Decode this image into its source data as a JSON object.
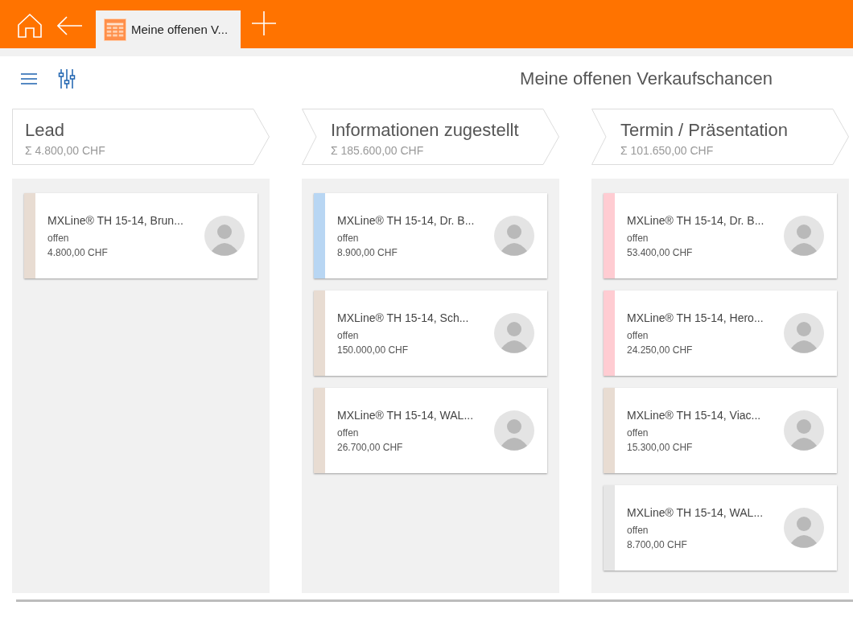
{
  "tabs": [
    {
      "label": "Meine offenen V...",
      "selected": true
    }
  ],
  "page_title": "Meine offenen Verkaufschancen",
  "columns": [
    {
      "title": "Lead",
      "sum": "Σ 4.800,00 CHF",
      "cards": [
        {
          "title": "MXLine® TH 15-14, Brun...",
          "status": "offen",
          "amount": "4.800,00 CHF",
          "color": "#e8dcd2"
        }
      ]
    },
    {
      "title": "Informationen zugestellt",
      "sum": "Σ 185.600,00 CHF",
      "cards": [
        {
          "title": "MXLine® TH 15-14, Dr. B...",
          "status": "offen",
          "amount": "8.900,00 CHF",
          "color": "#b8d6f3"
        },
        {
          "title": "MXLine® TH 15-14, Sch...",
          "status": "offen",
          "amount": "150.000,00 CHF",
          "color": "#e8dcd2"
        },
        {
          "title": "MXLine® TH 15-14, WAL...",
          "status": "offen",
          "amount": "26.700,00 CHF",
          "color": "#e8dcd2"
        }
      ]
    },
    {
      "title": "Termin / Präsentation",
      "sum": "Σ 101.650,00 CHF",
      "cards": [
        {
          "title": "MXLine® TH 15-14, Dr. B...",
          "status": "offen",
          "amount": "53.400,00 CHF",
          "color": "#ffccd2"
        },
        {
          "title": "MXLine® TH 15-14, Hero...",
          "status": "offen",
          "amount": "24.250,00 CHF",
          "color": "#ffccd2"
        },
        {
          "title": "MXLine® TH 15-14, Viac...",
          "status": "offen",
          "amount": "15.300,00 CHF",
          "color": "#e8dcd2"
        },
        {
          "title": "MXLine® TH 15-14, WAL...",
          "status": "offen",
          "amount": "8.700,00 CHF",
          "color": "#e6e6e6"
        }
      ]
    }
  ]
}
